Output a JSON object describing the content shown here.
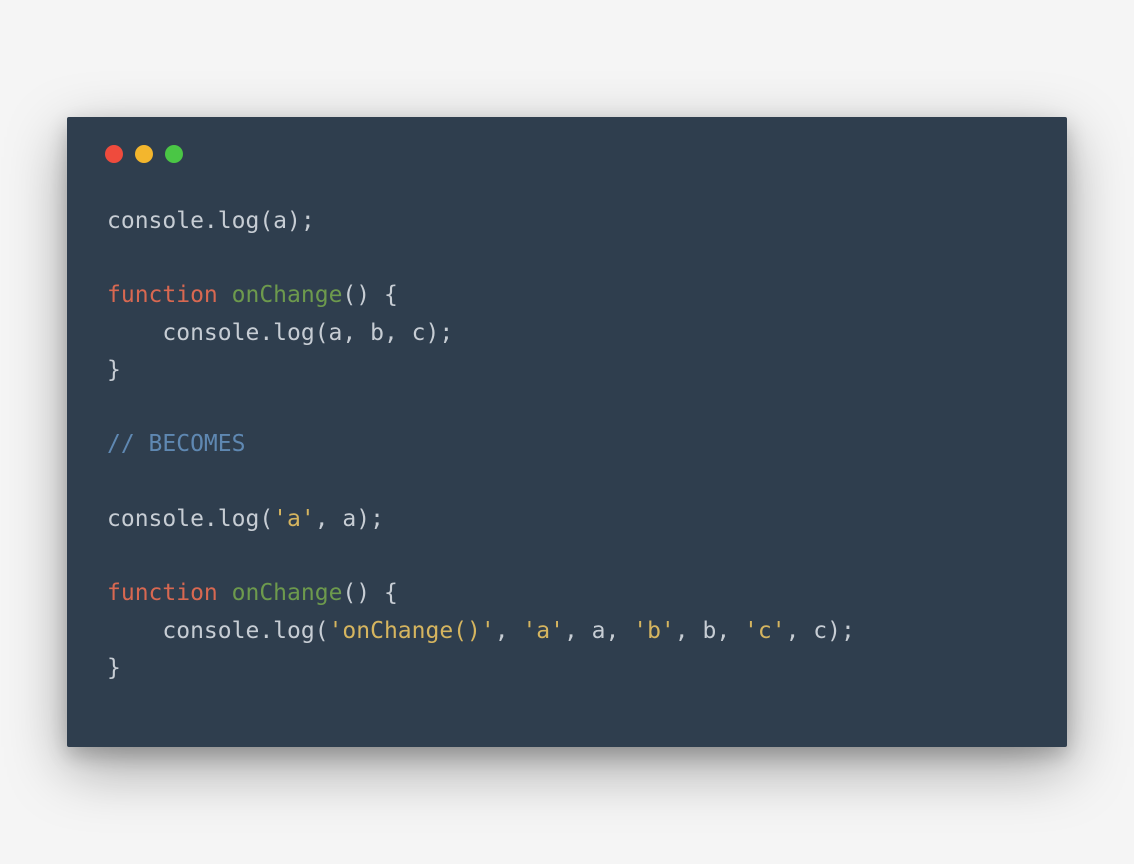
{
  "window": {
    "dots": [
      "red",
      "yellow",
      "green"
    ]
  },
  "code": {
    "tokens": [
      [
        {
          "t": "default",
          "v": "console.log(a);"
        }
      ],
      [],
      [
        {
          "t": "keyword",
          "v": "function"
        },
        {
          "t": "default",
          "v": " "
        },
        {
          "t": "func",
          "v": "onChange"
        },
        {
          "t": "default",
          "v": "() {"
        }
      ],
      [
        {
          "t": "default",
          "v": "    console.log(a, b, c);"
        }
      ],
      [
        {
          "t": "default",
          "v": "}"
        }
      ],
      [],
      [
        {
          "t": "comment",
          "v": "// BECOMES"
        }
      ],
      [],
      [
        {
          "t": "default",
          "v": "console.log("
        },
        {
          "t": "string",
          "v": "'a'"
        },
        {
          "t": "default",
          "v": ", a);"
        }
      ],
      [],
      [
        {
          "t": "keyword",
          "v": "function"
        },
        {
          "t": "default",
          "v": " "
        },
        {
          "t": "func",
          "v": "onChange"
        },
        {
          "t": "default",
          "v": "() {"
        }
      ],
      [
        {
          "t": "default",
          "v": "    console.log("
        },
        {
          "t": "string",
          "v": "'onChange()'"
        },
        {
          "t": "default",
          "v": ", "
        },
        {
          "t": "string",
          "v": "'a'"
        },
        {
          "t": "default",
          "v": ", a, "
        },
        {
          "t": "string",
          "v": "'b'"
        },
        {
          "t": "default",
          "v": ", b, "
        },
        {
          "t": "string",
          "v": "'c'"
        },
        {
          "t": "default",
          "v": ", c);"
        }
      ],
      [
        {
          "t": "default",
          "v": "}"
        }
      ]
    ]
  }
}
